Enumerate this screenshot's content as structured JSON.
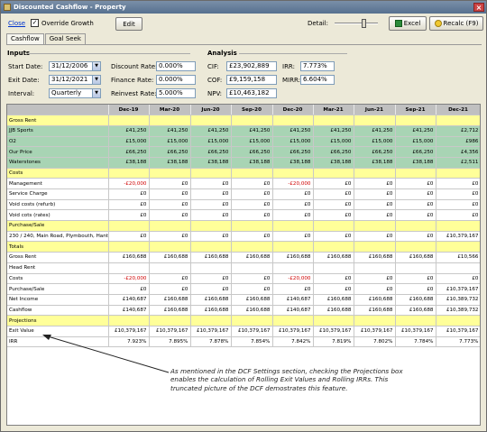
{
  "window": {
    "title": "Discounted Cashflow - Property"
  },
  "toolbar": {
    "close_label": "Close",
    "override_label": "Override Growth",
    "override_checked": true,
    "edit_label": "Edit",
    "detail_label": "Detail:",
    "detail_level": 0.7,
    "excel_label": "Excel",
    "recalc_label": "Recalc (F9)"
  },
  "tabs": [
    {
      "label": "Cashflow",
      "active": true
    },
    {
      "label": "Goal Seek",
      "active": false
    }
  ],
  "inputs": {
    "heading": "Inputs",
    "start_date_label": "Start Date:",
    "start_date": "31/12/2006",
    "exit_date_label": "Exit Date:",
    "exit_date": "31/12/2021",
    "interval_label": "Interval:",
    "interval": "Quarterly",
    "discount_rate_label": "Discount Rate:",
    "discount_rate": "0.000%",
    "finance_rate_label": "Finance Rate:",
    "finance_rate": "0.000%",
    "reinvest_rate_label": "Reinvest Rate:",
    "reinvest_rate": "5.000%"
  },
  "analysis": {
    "heading": "Analysis",
    "cif_label": "CIF:",
    "cif": "£23,902,889",
    "cof_label": "COF:",
    "cof": "£9,159,158",
    "npv_label": "NPV:",
    "npv": "£10,463,182",
    "irr_label": "IRR:",
    "irr": "7.773%",
    "mirr_label": "MIRR:",
    "mirr": "6.604%"
  },
  "grid": {
    "columns": [
      "",
      "Dec-19",
      "Mar-20",
      "Jun-20",
      "Sep-20",
      "Dec-20",
      "Mar-21",
      "Jun-21",
      "Sep-21",
      "Dec-21"
    ],
    "rows": [
      {
        "label": "Gross Rent",
        "kind": "section",
        "values": [
          "",
          "",
          "",
          "",
          "",
          "",
          "",
          "",
          ""
        ]
      },
      {
        "label": "JJB Sports",
        "kind": "green",
        "values": [
          "£41,250",
          "£41,250",
          "£41,250",
          "£41,250",
          "£41,250",
          "£41,250",
          "£41,250",
          "£41,250",
          "£2,712"
        ]
      },
      {
        "label": "O2",
        "kind": "green",
        "values": [
          "£15,000",
          "£15,000",
          "£15,000",
          "£15,000",
          "£15,000",
          "£15,000",
          "£15,000",
          "£15,000",
          "£986"
        ]
      },
      {
        "label": "Our Price",
        "kind": "green",
        "values": [
          "£66,250",
          "£66,250",
          "£66,250",
          "£66,250",
          "£66,250",
          "£66,250",
          "£66,250",
          "£66,250",
          "£4,356"
        ]
      },
      {
        "label": "Waterstones",
        "kind": "green",
        "values": [
          "£38,188",
          "£38,188",
          "£38,188",
          "£38,188",
          "£38,188",
          "£38,188",
          "£38,188",
          "£38,188",
          "£2,511"
        ]
      },
      {
        "label": "Costs",
        "kind": "section",
        "values": [
          "",
          "",
          "",
          "",
          "",
          "",
          "",
          "",
          ""
        ]
      },
      {
        "label": "Management",
        "kind": "plain",
        "values": [
          "-£20,000",
          "£0",
          "£0",
          "£0",
          "-£20,000",
          "£0",
          "£0",
          "£0",
          "£0"
        ]
      },
      {
        "label": "Service Charge",
        "kind": "plain",
        "values": [
          "£0",
          "£0",
          "£0",
          "£0",
          "£0",
          "£0",
          "£0",
          "£0",
          "£0"
        ]
      },
      {
        "label": "Void costs (refurb)",
        "kind": "plain",
        "values": [
          "£0",
          "£0",
          "£0",
          "£0",
          "£0",
          "£0",
          "£0",
          "£0",
          "£0"
        ]
      },
      {
        "label": "Void cots (rates)",
        "kind": "plain",
        "values": [
          "£0",
          "£0",
          "£0",
          "£0",
          "£0",
          "£0",
          "£0",
          "£0",
          "£0"
        ]
      },
      {
        "label": "Purchase/Sale",
        "kind": "section",
        "values": [
          "",
          "",
          "",
          "",
          "",
          "",
          "",
          "",
          ""
        ]
      },
      {
        "label": "230 / 240, Main Road, Plymbouth, Hants",
        "kind": "plain",
        "values": [
          "£0",
          "£0",
          "£0",
          "£0",
          "£0",
          "£0",
          "£0",
          "£0",
          "£10,379,167"
        ]
      },
      {
        "label": "Totals",
        "kind": "section",
        "values": [
          "",
          "",
          "",
          "",
          "",
          "",
          "",
          "",
          ""
        ]
      },
      {
        "label": "Gross Rent",
        "kind": "plain",
        "values": [
          "£160,688",
          "£160,688",
          "£160,688",
          "£160,688",
          "£160,688",
          "£160,688",
          "£160,688",
          "£160,688",
          "£10,566"
        ]
      },
      {
        "label": "Head Rent",
        "kind": "plain",
        "values": [
          "",
          "",
          "",
          "",
          "",
          "",
          "",
          "",
          ""
        ]
      },
      {
        "label": "Costs",
        "kind": "plain",
        "values": [
          "-£20,000",
          "£0",
          "£0",
          "£0",
          "-£20,000",
          "£0",
          "£0",
          "£0",
          "£0"
        ]
      },
      {
        "label": "Purchase/Sale",
        "kind": "plain",
        "values": [
          "£0",
          "£0",
          "£0",
          "£0",
          "£0",
          "£0",
          "£0",
          "£0",
          "£10,379,167"
        ]
      },
      {
        "label": "Net Income",
        "kind": "plain",
        "values": [
          "£140,687",
          "£160,688",
          "£160,688",
          "£160,688",
          "£140,687",
          "£160,688",
          "£160,688",
          "£160,688",
          "£10,389,732"
        ]
      },
      {
        "label": "Cashflow",
        "kind": "plain",
        "values": [
          "£140,687",
          "£160,688",
          "£160,688",
          "£160,688",
          "£140,687",
          "£160,688",
          "£160,688",
          "£160,688",
          "£10,389,732"
        ]
      },
      {
        "label": "Projections",
        "kind": "section",
        "values": [
          "",
          "",
          "",
          "",
          "",
          "",
          "",
          "",
          ""
        ]
      },
      {
        "label": "Exit Value",
        "kind": "plain",
        "values": [
          "£10,379,167",
          "£10,379,167",
          "£10,379,167",
          "£10,379,167",
          "£10,379,167",
          "£10,379,167",
          "£10,379,167",
          "£10,379,167",
          "£10,379,167"
        ]
      },
      {
        "label": "IRR",
        "kind": "plain",
        "values": [
          "7.923%",
          "7.895%",
          "7.878%",
          "7.854%",
          "7.842%",
          "7.819%",
          "7.802%",
          "7.784%",
          "7.773%"
        ]
      }
    ]
  },
  "annotation": {
    "text": "As mentioned in the DCF Settings section, checking the Projections box enables the calculation of Rolling Exit Values and Rolling IRRs. This truncated picture of the DCF demostrates this feature."
  },
  "colors": {
    "section_yellow": "#ffff99",
    "tenant_green": "#a8d4b4",
    "negative_red": "#d00000",
    "header_gray": "#c0c0c0"
  }
}
